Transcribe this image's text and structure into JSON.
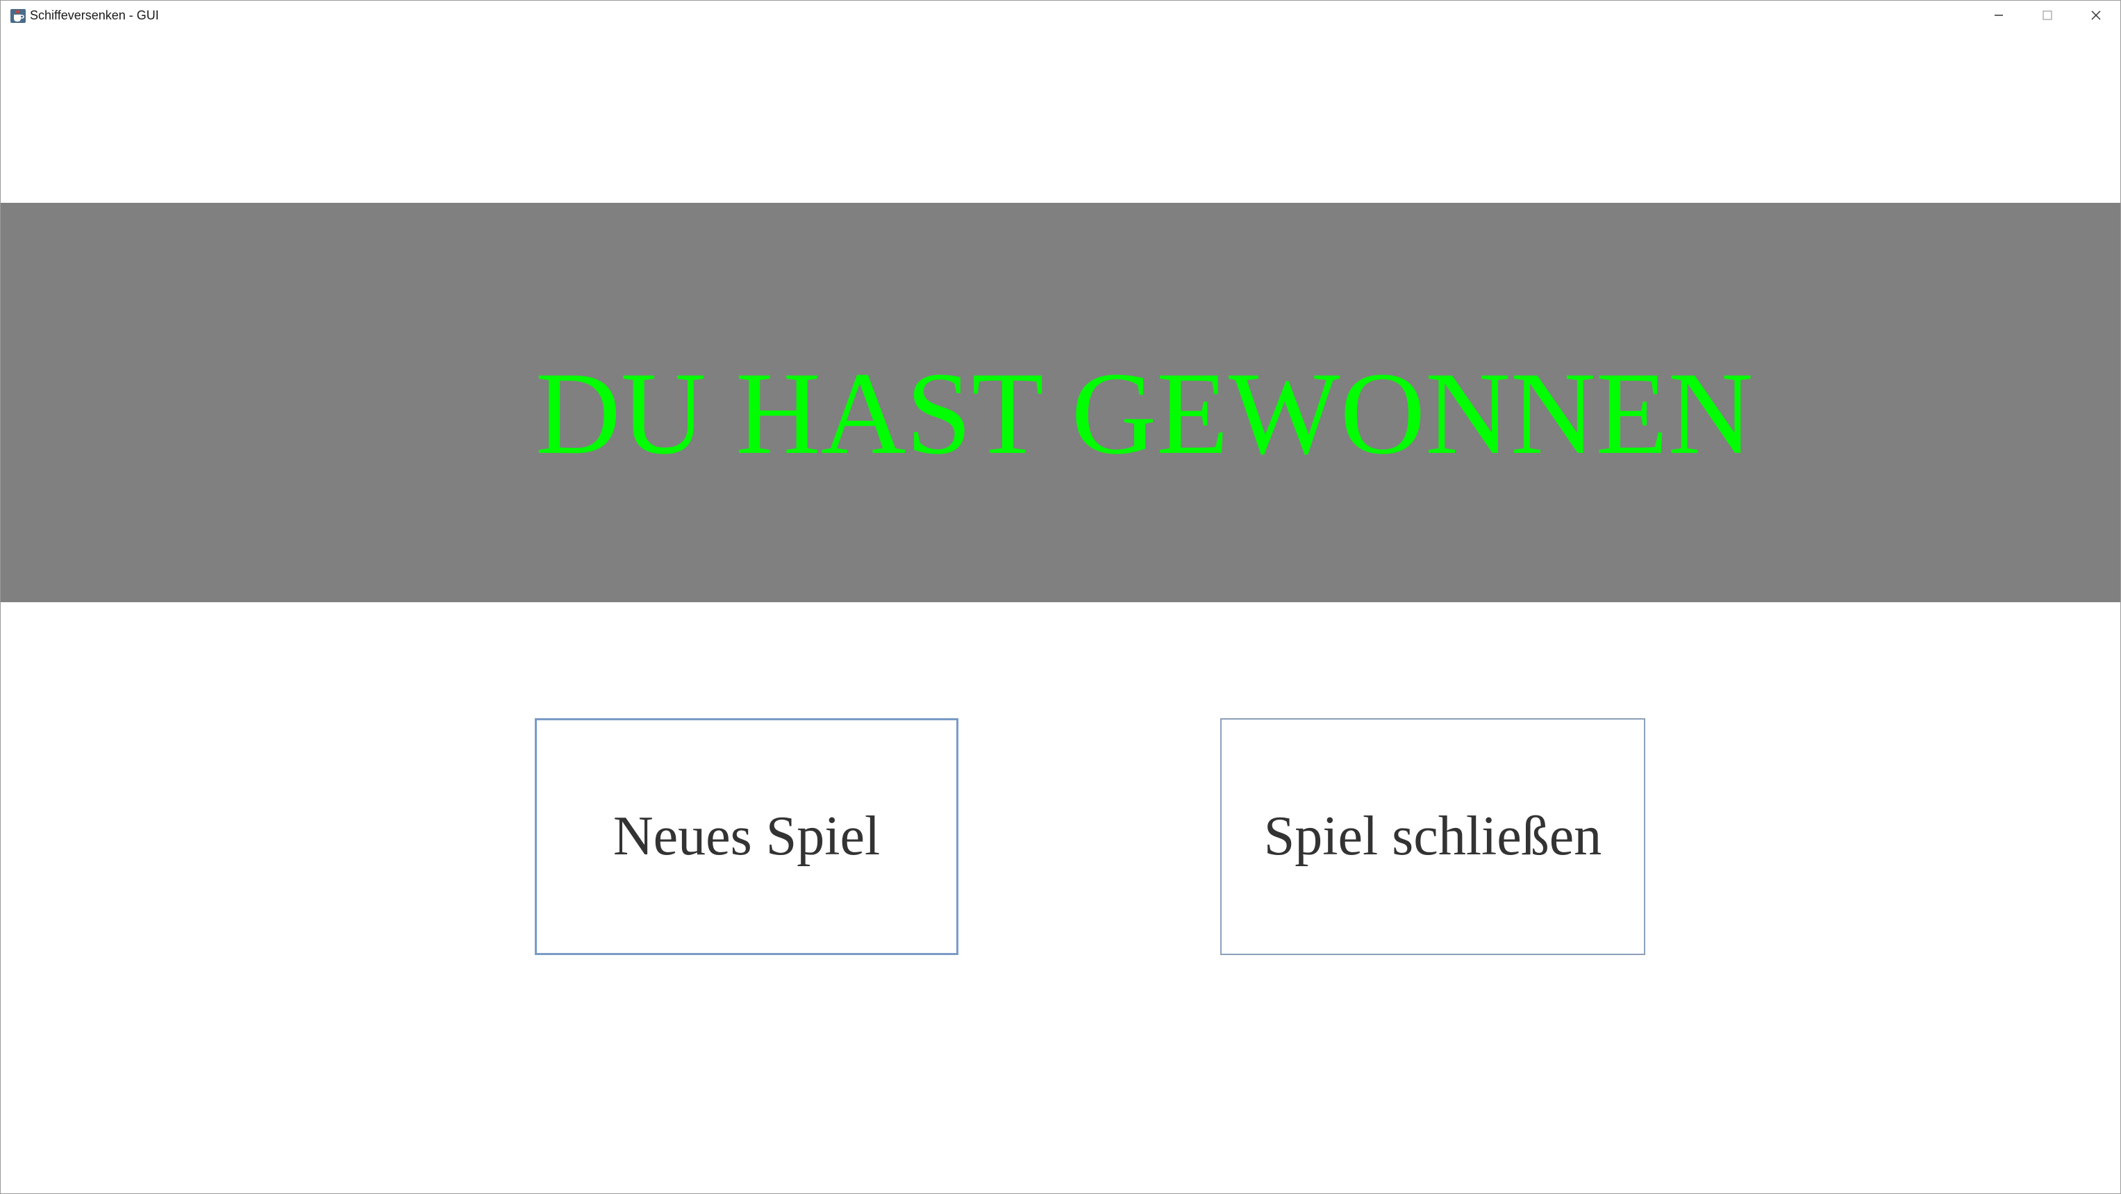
{
  "window": {
    "title": "Schiffeversenken - GUI",
    "icons": {
      "app": "java-cup-icon",
      "minimize": "minimize-icon",
      "maximize": "maximize-icon",
      "close": "close-icon"
    }
  },
  "banner": {
    "message": "DU HAST GEWONNEN",
    "background_color": "#808080",
    "text_color": "#00ff00"
  },
  "buttons": {
    "new_game_label": "Neues Spiel",
    "close_game_label": "Spiel schließen"
  }
}
